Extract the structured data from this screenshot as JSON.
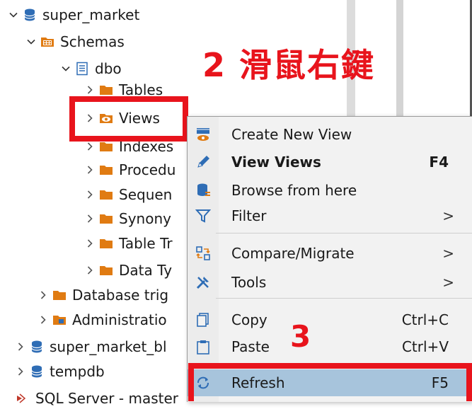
{
  "tree": {
    "items": [
      {
        "label": "super_market",
        "expanded": true
      },
      {
        "label": "Schemas",
        "expanded": true
      },
      {
        "label": "dbo",
        "expanded": true
      },
      {
        "label": "Tables",
        "expanded": false
      },
      {
        "label": "Views",
        "expanded": false
      },
      {
        "label": "Indexes",
        "expanded": false
      },
      {
        "label": "Procedu",
        "expanded": false
      },
      {
        "label": "Sequen",
        "expanded": false
      },
      {
        "label": "Synony",
        "expanded": false
      },
      {
        "label": "Table Tr",
        "expanded": false
      },
      {
        "label": "Data Ty",
        "expanded": false
      },
      {
        "label": "Database trig",
        "expanded": false
      },
      {
        "label": "Administratio",
        "expanded": false
      },
      {
        "label": "super_market_bl",
        "expanded": false
      },
      {
        "label": "tempdb",
        "expanded": false
      },
      {
        "label": "SQL Server - master",
        "expanded": false
      }
    ]
  },
  "annotations": {
    "step2": "2 滑鼠右鍵",
    "step3": "3"
  },
  "context_menu": {
    "items": [
      {
        "label": "Create New View",
        "shortcut": "",
        "icon": "view-add-icon"
      },
      {
        "label": "View Views",
        "shortcut": "F4",
        "icon": "pencil-icon"
      },
      {
        "label": "Browse from here",
        "shortcut": "",
        "icon": "database-browse-icon"
      },
      {
        "label": "Filter",
        "shortcut": "",
        "icon": "filter-icon",
        "submenu": true
      },
      {
        "label": "Compare/Migrate",
        "shortcut": "",
        "icon": "compare-icon",
        "submenu": true
      },
      {
        "label": "Tools",
        "shortcut": "",
        "icon": "tools-icon",
        "submenu": true
      },
      {
        "label": "Copy",
        "shortcut": "Ctrl+C",
        "icon": "copy-icon"
      },
      {
        "label": "Paste",
        "shortcut": "Ctrl+V",
        "icon": "paste-icon"
      },
      {
        "label": "Refresh",
        "shortcut": "F5",
        "icon": "refresh-icon"
      }
    ],
    "submenu_arrow": ">"
  },
  "colors": {
    "annotation_red": "#e8141c",
    "folder_orange": "#e07b12",
    "hover_blue": "#a7c4dc",
    "db_blue": "#2f6db5"
  }
}
